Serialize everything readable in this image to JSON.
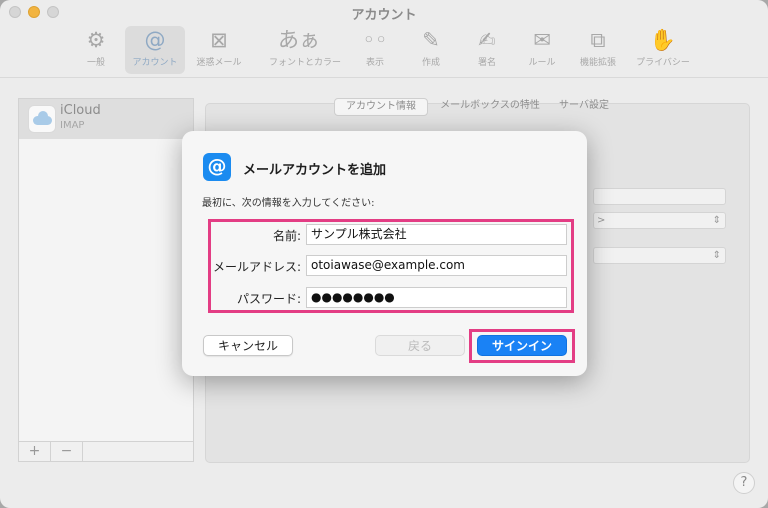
{
  "window": {
    "title": "アカウント"
  },
  "toolbar": {
    "items": [
      {
        "label": "一般",
        "icon": "⚙"
      },
      {
        "label": "アカウント",
        "icon": "@"
      },
      {
        "label": "迷惑メール",
        "icon": "⊠"
      },
      {
        "label": "フォントとカラー",
        "icon": "あぁ"
      },
      {
        "label": "表示",
        "icon": "◦◦"
      },
      {
        "label": "作成",
        "icon": "✎"
      },
      {
        "label": "署名",
        "icon": "✍"
      },
      {
        "label": "ルール",
        "icon": "✉"
      },
      {
        "label": "機能拡張",
        "icon": "⧉"
      },
      {
        "label": "プライバシー",
        "icon": "✋"
      }
    ]
  },
  "sidebar": {
    "accounts": [
      {
        "name": "iCloud",
        "type": "IMAP"
      }
    ],
    "add_label": "+",
    "remove_label": "−"
  },
  "tabs": [
    {
      "label": "アカウント情報"
    },
    {
      "label": "メールボックスの特性"
    },
    {
      "label": "サーバ設定"
    }
  ],
  "background_fields": {
    "popup1_suffix": ">"
  },
  "help": {
    "label": "?"
  },
  "dialog": {
    "icon_glyph": "@",
    "title": "メールアカウントを追加",
    "instruction": "最初に、次の情報を入力してください:",
    "fields": {
      "name": {
        "label": "名前:",
        "value": "サンプル株式会社"
      },
      "email": {
        "label": "メールアドレス:",
        "value": "otoiawase@example.com"
      },
      "password": {
        "label": "パスワード:",
        "value": "●●●●●●●●"
      }
    },
    "buttons": {
      "cancel": "キャンセル",
      "back": "戻る",
      "signin": "サインイン"
    }
  },
  "colors": {
    "highlight": "#e33d84",
    "accent": "#1a82f5"
  }
}
